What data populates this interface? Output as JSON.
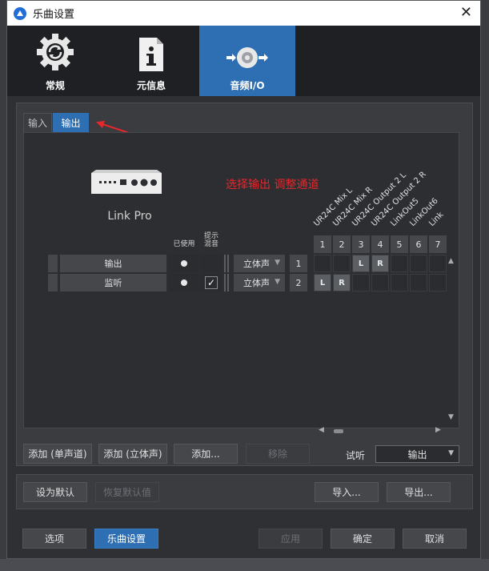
{
  "window": {
    "title": "乐曲设置"
  },
  "categories": [
    {
      "label": "常规",
      "icon": "gear-icon",
      "active": false
    },
    {
      "label": "元信息",
      "icon": "info-icon",
      "active": false
    },
    {
      "label": "音频I/O",
      "icon": "speaker-icon",
      "active": true
    }
  ],
  "tabs": {
    "input": "输入",
    "output": "输出"
  },
  "device": {
    "name": "Link Pro"
  },
  "annotation": "选择输出 调整通道",
  "columns": {
    "used": "已使用",
    "hint_line1": "提示",
    "hint_line2": "混音"
  },
  "channels": {
    "labels": [
      "UR24C Mix L",
      "UR24C Mix R",
      "UR24C Output 2 L",
      "UR24C Output 2 R",
      "LinkOut5",
      "LinkOut6",
      "Link"
    ],
    "numbers": [
      "1",
      "2",
      "3",
      "4",
      "5",
      "6",
      "7"
    ]
  },
  "rows": [
    {
      "name": "输出",
      "format": "立体声",
      "index": "1",
      "used": true,
      "hint": false,
      "assign": [
        "",
        "",
        "L",
        "R",
        "",
        "",
        ""
      ]
    },
    {
      "name": "监听",
      "format": "立体声",
      "index": "2",
      "used": true,
      "hint": true,
      "assign": [
        "L",
        "R",
        "",
        "",
        "",
        "",
        ""
      ]
    }
  ],
  "buttons": {
    "add_mono": "添加 (单声道)",
    "add_stereo": "添加 (立体声)",
    "add": "添加...",
    "remove": "移除",
    "set_default": "设为默认",
    "restore_default": "恢复默认值",
    "import": "导入...",
    "export": "导出...",
    "options": "选项",
    "song_settings": "乐曲设置",
    "apply": "应用",
    "ok": "确定",
    "cancel": "取消"
  },
  "listen": {
    "label": "试听",
    "value": "输出"
  },
  "colors": {
    "accent": "#2e6fb4",
    "annotation": "#e8262b"
  }
}
